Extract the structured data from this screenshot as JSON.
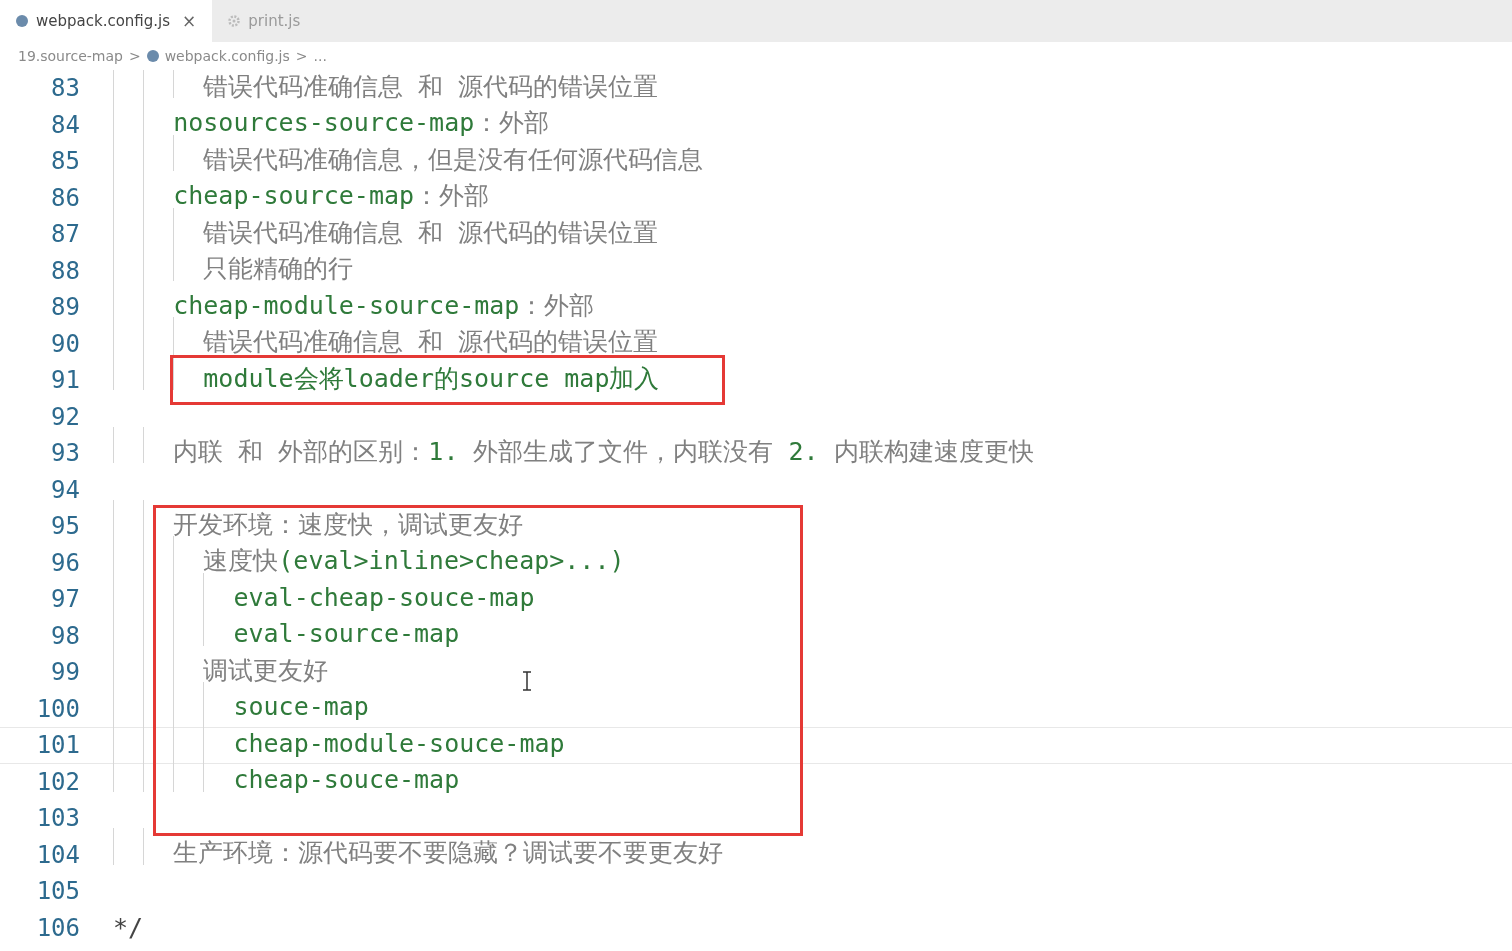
{
  "tabs": [
    {
      "label": "webpack.config.js",
      "kind": "script",
      "selected": true,
      "close": "×"
    },
    {
      "label": "print.js",
      "kind": "settings",
      "selected": false
    }
  ],
  "breadcrumbs": {
    "items": [
      {
        "label": "19.source-map",
        "kind": "folder"
      },
      {
        "label": "webpack.config.js",
        "kind": "script"
      },
      {
        "label": "...",
        "kind": "symbol"
      }
    ],
    "separator": ">"
  },
  "editor": {
    "blocks": [
      {
        "kind": "plain",
        "lines": [
          {
            "number": "83",
            "current": false,
            "parts": [
              {
                "text": "      错误代码准确信息 和 源代码的错误位置",
                "kind": "comment"
              }
            ]
          },
          {
            "number": "84",
            "current": false,
            "parts": [
              {
                "text": "    nosources-source-map",
                "kind": "code"
              },
              {
                "text": "：外部",
                "kind": "comment"
              }
            ]
          },
          {
            "number": "85",
            "current": false,
            "parts": [
              {
                "text": "      错误代码准确信息，但是没有任何源代码信息",
                "kind": "comment"
              }
            ]
          },
          {
            "number": "86",
            "current": false,
            "parts": [
              {
                "text": "    cheap-source-map",
                "kind": "code"
              },
              {
                "text": "：外部",
                "kind": "comment"
              }
            ]
          },
          {
            "number": "87",
            "current": false,
            "parts": [
              {
                "text": "      错误代码准确信息 和 源代码的错误位置",
                "kind": "comment"
              }
            ]
          },
          {
            "number": "88",
            "current": false,
            "parts": [
              {
                "text": "      只能精确的行",
                "kind": "comment"
              }
            ]
          },
          {
            "number": "89",
            "current": false,
            "parts": [
              {
                "text": "    cheap-module-source-map",
                "kind": "code"
              },
              {
                "text": "：外部",
                "kind": "comment"
              }
            ]
          },
          {
            "number": "90",
            "current": false,
            "parts": [
              {
                "text": "      错误代码准确信息 和 源代码的错误位置",
                "kind": "comment"
              }
            ]
          }
        ]
      },
      {
        "kind": "red-box",
        "lines": [
          {
            "number": "91",
            "current": false,
            "parts": [
              {
                "text": "      module会将loader的source map加入",
                "kind": "code"
              }
            ]
          }
        ]
      },
      {
        "kind": "plain",
        "lines": [
          {
            "number": "92",
            "current": false
          },
          {
            "number": "93",
            "current": false,
            "parts": [
              {
                "text": "    内联 和 外部的区别：",
                "kind": "comment"
              },
              {
                "text": "1.",
                "kind": "code"
              },
              {
                "text": " 外部生成了文件，内联没有 ",
                "kind": "comment"
              },
              {
                "text": "2.",
                "kind": "code"
              },
              {
                "text": " 内联构建速度更快",
                "kind": "comment"
              }
            ]
          },
          {
            "number": "94",
            "current": false
          }
        ]
      },
      {
        "kind": "red-box",
        "lines": [
          {
            "number": "95",
            "current": false,
            "parts": [
              {
                "text": "    开发环境：速度快，调试更友好",
                "kind": "comment"
              }
            ]
          },
          {
            "number": "96",
            "current": false,
            "parts": [
              {
                "text": "      速度快",
                "kind": "comment"
              },
              {
                "text": "(eval>inline>cheap>...)",
                "kind": "code"
              }
            ]
          },
          {
            "number": "97",
            "current": false,
            "parts": [
              {
                "text": "        eval-cheap-souce-map",
                "kind": "code"
              }
            ]
          },
          {
            "number": "98",
            "current": false,
            "parts": [
              {
                "text": "        eval-source-map",
                "kind": "code"
              }
            ]
          },
          {
            "number": "99",
            "current": false,
            "parts": [
              {
                "text": "      调试更友好",
                "kind": "comment"
              }
            ]
          },
          {
            "number": "100",
            "current": false,
            "parts": [
              {
                "text": "        souce-map",
                "kind": "code"
              }
            ]
          },
          {
            "number": "101",
            "current": true,
            "parts": [
              {
                "text": "        cheap-module-souce-map",
                "kind": "code"
              }
            ]
          },
          {
            "number": "102",
            "current": false,
            "parts": [
              {
                "text": "        cheap-souce-map",
                "kind": "code"
              }
            ]
          },
          {
            "number": "103",
            "current": false
          }
        ]
      },
      {
        "kind": "plain",
        "lines": [
          {
            "number": "104",
            "current": false,
            "parts": [
              {
                "text": "    生产环境：源代码要不要隐藏？调试要不要更友好",
                "kind": "comment"
              }
            ]
          },
          {
            "number": "105",
            "current": false
          },
          {
            "number": "106",
            "current": false,
            "parts": [
              {
                "text": "*/",
                "kind": "plain"
              }
            ]
          }
        ]
      }
    ]
  }
}
